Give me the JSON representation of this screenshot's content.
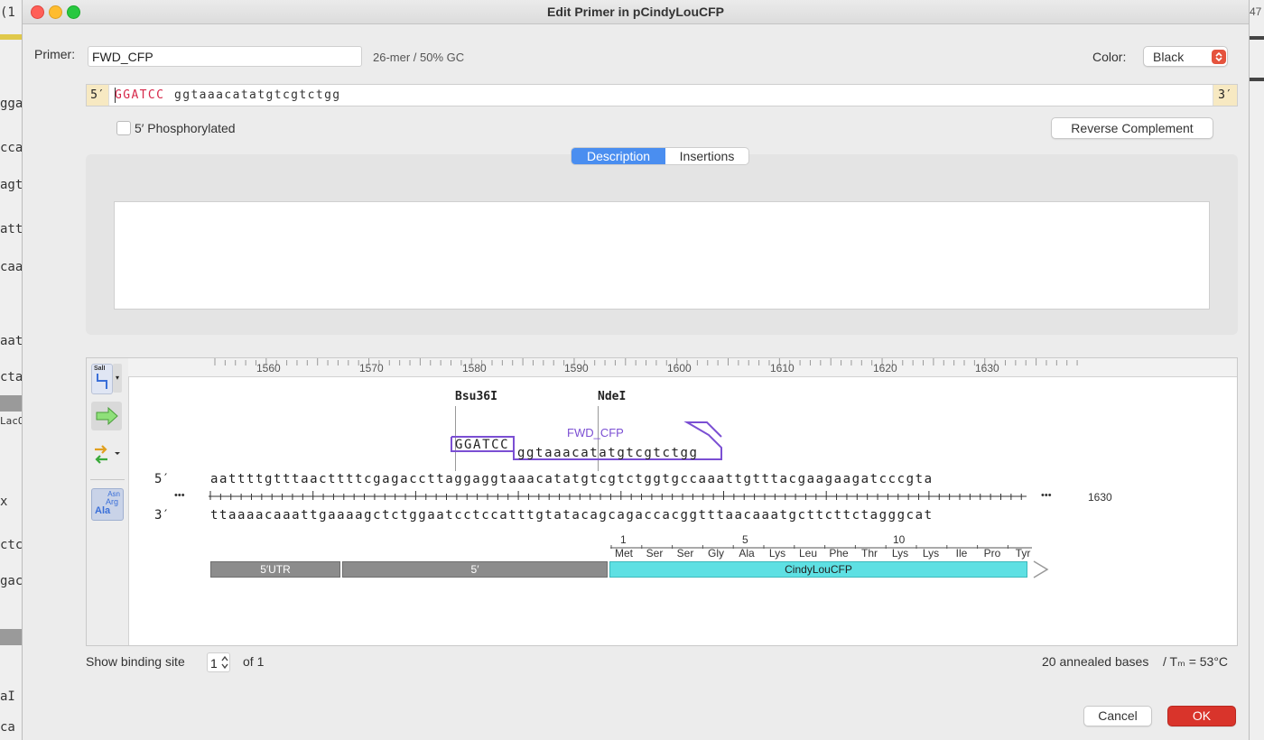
{
  "window": {
    "title": "Edit Primer in pCindyLouCFP"
  },
  "primer": {
    "label": "Primer:",
    "name": "FWD_CFP",
    "stats": "26-mer  /  50% GC",
    "color_label": "Color:",
    "color_value": "Black",
    "seq_5prime": "5′",
    "seq_3prime": "3′",
    "seq_upper": "GGATCC",
    "seq_lower": "ggtaaacatatgtcgtctgg",
    "phosphorylated_label": "5′ Phosphorylated",
    "phosphorylated": false,
    "reverse_complement_label": "Reverse Complement"
  },
  "tabs": [
    {
      "label": "Description",
      "active": true
    },
    {
      "label": "Insertions",
      "active": false
    }
  ],
  "description_text": "",
  "map": {
    "ruler_labels": [
      "1560",
      "1570",
      "1580",
      "1590",
      "1600",
      "1610",
      "1620",
      "1630"
    ],
    "enzymes": [
      "Bsu36I",
      "NdeI"
    ],
    "primer_label": "FWD_CFP",
    "primer_overhang": "GGATCC",
    "primer_bound": "ggtaaacatatgtcgtctgg",
    "strand_top_label": "5′",
    "strand_bottom_label": "3′",
    "top_strand": "aattttgtttaacttttcgagaccttaggaggtaaacatatgtcgtctggtgccaaattgtttacgaagaagatcccgta",
    "bottom_strand": "ttaaaacaaattgaaaagctctggaatcctccatttgtatacagcagaccacggtttaacaaatgcttcttctagggcat",
    "ellipsis": "•••",
    "end_position": "1630",
    "aa_numbers": [
      "1",
      "5",
      "10"
    ],
    "amino_acids": [
      "Met",
      "Ser",
      "Ser",
      "Gly",
      "Ala",
      "Lys",
      "Leu",
      "Phe",
      "Thr",
      "Lys",
      "Lys",
      "Ile",
      "Pro",
      "Tyr"
    ],
    "features": [
      {
        "label": "5′UTR",
        "color": "#8c8c8c"
      },
      {
        "label": "5′",
        "color": "#8c8c8c"
      },
      {
        "label": "CindyLouCFP",
        "color": "#5ee0e3"
      }
    ],
    "tool_icons": [
      "sali-enzyme-icon",
      "forward-arrow-icon",
      "swap-strand-icon",
      "amino-acid-icon"
    ],
    "tool_text": {
      "sali": "SalI",
      "asn": "Asn",
      "arg": "Arg",
      "ala": "Ala"
    }
  },
  "footer": {
    "binding_label": "Show binding site",
    "binding_value": "1",
    "binding_of": "of 1",
    "annealed": "20 annealed bases",
    "tm": "/ Tₘ = 53°C",
    "cancel_label": "Cancel",
    "ok_label": "OK"
  },
  "colors": {
    "accent_blue": "#4a8ef0",
    "primer_purple": "#7b4fd3",
    "ok_red": "#d9342b",
    "cfp_cyan": "#5ee0e3",
    "seq_red": "#d6284a"
  },
  "background_fragments": [
    "(1",
    "gga",
    "cca",
    "agt",
    "att",
    "caa",
    "aat",
    "cta",
    "LacO",
    "x",
    "ctc",
    "gac",
    "aI",
    "ca",
    "47"
  ]
}
